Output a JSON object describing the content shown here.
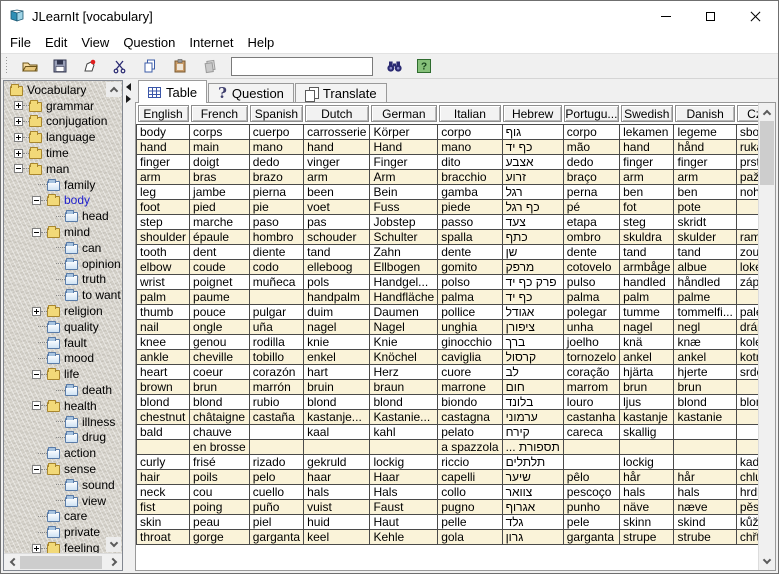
{
  "window": {
    "title": "JLearnIt [vocabulary]"
  },
  "menu": {
    "items": [
      "File",
      "Edit",
      "View",
      "Question",
      "Internet",
      "Help"
    ]
  },
  "toolbar": {
    "search_value": ""
  },
  "tree": {
    "items": [
      {
        "label": "Vocabulary",
        "level": 0,
        "folder": "yellow",
        "handle": null,
        "selected": false
      },
      {
        "label": "grammar",
        "level": 1,
        "folder": "yellow",
        "handle": "plus",
        "selected": false
      },
      {
        "label": "conjugation",
        "level": 1,
        "folder": "yellow",
        "handle": "plus",
        "selected": false
      },
      {
        "label": "language",
        "level": 1,
        "folder": "yellow",
        "handle": "plus",
        "selected": false
      },
      {
        "label": "time",
        "level": 1,
        "folder": "yellow",
        "handle": "plus",
        "selected": false
      },
      {
        "label": "man",
        "level": 1,
        "folder": "yellow",
        "handle": "minus",
        "selected": false
      },
      {
        "label": "family",
        "level": 2,
        "folder": "blue",
        "handle": null,
        "selected": false
      },
      {
        "label": "body",
        "level": 2,
        "folder": "yellow",
        "handle": "minus",
        "selected": true
      },
      {
        "label": "head",
        "level": 3,
        "folder": "blue",
        "handle": null,
        "selected": false
      },
      {
        "label": "mind",
        "level": 2,
        "folder": "yellow",
        "handle": "minus",
        "selected": false
      },
      {
        "label": "can",
        "level": 3,
        "folder": "blue",
        "handle": null,
        "selected": false
      },
      {
        "label": "opinion",
        "level": 3,
        "folder": "blue",
        "handle": null,
        "selected": false
      },
      {
        "label": "truth",
        "level": 3,
        "folder": "blue",
        "handle": null,
        "selected": false
      },
      {
        "label": "to want",
        "level": 3,
        "folder": "blue",
        "handle": null,
        "selected": false
      },
      {
        "label": "religion",
        "level": 2,
        "folder": "yellow",
        "handle": "plus",
        "selected": false
      },
      {
        "label": "quality",
        "level": 2,
        "folder": "blue",
        "handle": null,
        "selected": false
      },
      {
        "label": "fault",
        "level": 2,
        "folder": "blue",
        "handle": null,
        "selected": false
      },
      {
        "label": "mood",
        "level": 2,
        "folder": "blue",
        "handle": null,
        "selected": false
      },
      {
        "label": "life",
        "level": 2,
        "folder": "yellow",
        "handle": "minus",
        "selected": false
      },
      {
        "label": "death",
        "level": 3,
        "folder": "blue",
        "handle": null,
        "selected": false
      },
      {
        "label": "health",
        "level": 2,
        "folder": "yellow",
        "handle": "minus",
        "selected": false
      },
      {
        "label": "illness",
        "level": 3,
        "folder": "blue",
        "handle": null,
        "selected": false
      },
      {
        "label": "drug",
        "level": 3,
        "folder": "blue",
        "handle": null,
        "selected": false
      },
      {
        "label": "action",
        "level": 2,
        "folder": "blue",
        "handle": null,
        "selected": false
      },
      {
        "label": "sense",
        "level": 2,
        "folder": "yellow",
        "handle": "minus",
        "selected": false
      },
      {
        "label": "sound",
        "level": 3,
        "folder": "blue",
        "handle": null,
        "selected": false
      },
      {
        "label": "view",
        "level": 3,
        "folder": "blue",
        "handle": null,
        "selected": false
      },
      {
        "label": "care",
        "level": 2,
        "folder": "blue",
        "handle": null,
        "selected": false
      },
      {
        "label": "private",
        "level": 2,
        "folder": "blue",
        "handle": null,
        "selected": false
      },
      {
        "label": "feeling",
        "level": 2,
        "folder": "yellow",
        "handle": "plus",
        "selected": false
      }
    ]
  },
  "tabs": [
    {
      "label": "Table",
      "icon": "table-icon",
      "selected": true
    },
    {
      "label": "Question",
      "icon": "question-icon",
      "selected": false
    },
    {
      "label": "Translate",
      "icon": "translate-icon",
      "selected": false
    }
  ],
  "table": {
    "columns": [
      "English",
      "French",
      "Spanish",
      "Dutch",
      "German",
      "Italian",
      "Hebrew",
      "Portugu...",
      "Swedish",
      "Danish",
      "Czech"
    ],
    "rtl_column_index": 6,
    "rows": [
      [
        "body",
        "corps",
        "cuerpo",
        "carrosserie",
        "Körper",
        "corpo",
        "גוף",
        "corpo",
        "lekamen",
        "legeme",
        "sbor"
      ],
      [
        "hand",
        "main",
        "mano",
        "hand",
        "Hand",
        "mano",
        "כף יד",
        "mão",
        "hand",
        "hånd",
        "ruka"
      ],
      [
        "finger",
        "doigt",
        "dedo",
        "vinger",
        "Finger",
        "dito",
        "אצבע",
        "dedo",
        "finger",
        "finger",
        "prst"
      ],
      [
        "arm",
        "bras",
        "brazo",
        "arm",
        "Arm",
        "bracchio",
        "זרוע",
        "braço",
        "arm",
        "arm",
        "paže"
      ],
      [
        "leg",
        "jambe",
        "pierna",
        "been",
        "Bein",
        "gamba",
        "רגל",
        "perna",
        "ben",
        "ben",
        "noha"
      ],
      [
        "foot",
        "pied",
        "pie",
        "voet",
        "Fuss",
        "piede",
        "כף רגל",
        "pé",
        "fot",
        "pote",
        ""
      ],
      [
        "step",
        "marche",
        "paso",
        "pas",
        "Jobstep",
        "passo",
        "צעד",
        "etapa",
        "steg",
        "skridt",
        ""
      ],
      [
        "shoulder",
        "épaule",
        "hombro",
        "schouder",
        "Schulter",
        "spalla",
        "כתף",
        "ombro",
        "skuldra",
        "skulder",
        "rameno"
      ],
      [
        "tooth",
        "dent",
        "diente",
        "tand",
        "Zahn",
        "dente",
        "שן",
        "dente",
        "tand",
        "tand",
        "zoubek"
      ],
      [
        "elbow",
        "coude",
        "codo",
        "elleboog",
        "Ellbogen",
        "gomito",
        "מרפק",
        "cotovelo",
        "armbåge",
        "albue",
        "loket"
      ],
      [
        "wrist",
        "poignet",
        "muñeca",
        "pols",
        "Handgel...",
        "polso",
        "פרק כף יד",
        "pulso",
        "handled",
        "håndled",
        "zápěstí"
      ],
      [
        "palm",
        "paume",
        "",
        "handpalm",
        "Handfläche",
        "palma",
        "כף יד",
        "palma",
        "palm",
        "palme",
        ""
      ],
      [
        "thumb",
        "pouce",
        "pulgar",
        "duim",
        "Daumen",
        "pollice",
        "אגודל",
        "polegar",
        "tumme",
        "tommelfi...",
        "palec"
      ],
      [
        "nail",
        "ongle",
        "uña",
        "nagel",
        "Nagel",
        "unghia",
        "ציפורן",
        "unha",
        "nagel",
        "negl",
        "dráp"
      ],
      [
        "knee",
        "genou",
        "rodilla",
        "knie",
        "Knie",
        "ginocchio",
        "ברך",
        "joelho",
        "knä",
        "knæ",
        "koleno"
      ],
      [
        "ankle",
        "cheville",
        "tobillo",
        "enkel",
        "Knöchel",
        "caviglia",
        "קרסול",
        "tornozelo",
        "ankel",
        "ankel",
        "kotník"
      ],
      [
        "heart",
        "coeur",
        "corazón",
        "hart",
        "Herz",
        "cuore",
        "לב",
        "coração",
        "hjärta",
        "hjerte",
        "srdce"
      ],
      [
        "brown",
        "brun",
        "marrón",
        "bruin",
        "braun",
        "marrone",
        "חום",
        "marrom",
        "brun",
        "brun",
        ""
      ],
      [
        "blond",
        "blond",
        "rubio",
        "blond",
        "blond",
        "biondo",
        "בלונד",
        "louro",
        "ljus",
        "blond",
        "blond"
      ],
      [
        "chestnut",
        "châtaigne",
        "castaña",
        "kastanje...",
        "Kastanie...",
        "castagna",
        "ערמוני",
        "castanha",
        "kastanje",
        "kastanie",
        ""
      ],
      [
        "bald",
        "chauve",
        "",
        "kaal",
        "kahl",
        "pelato",
        "קירח",
        "careca",
        "skallig",
        "",
        ""
      ],
      [
        "",
        "en brosse",
        "",
        "",
        "",
        "a spazzola",
        "... תספורת",
        "",
        "",
        "",
        ""
      ],
      [
        "curly",
        "frisé",
        "rizado",
        "gekruld",
        "lockig",
        "riccio",
        "תלתלים",
        "",
        "lockig",
        "",
        "kadeřavý"
      ],
      [
        "hair",
        "poils",
        "pelo",
        "haar",
        "Haar",
        "capelli",
        "שיער",
        "pêlo",
        "hår",
        "hår",
        "chlup"
      ],
      [
        "neck",
        "cou",
        "cuello",
        "hals",
        "Hals",
        "collo",
        "צוואר",
        "pescoço",
        "hals",
        "hals",
        "hrdlo"
      ],
      [
        "fist",
        "poing",
        "puño",
        "vuist",
        "Faust",
        "pugno",
        "אגרוף",
        "punho",
        "näve",
        "næve",
        "pěst"
      ],
      [
        "skin",
        "peau",
        "piel",
        "huid",
        "Haut",
        "pelle",
        "גלד",
        "pele",
        "skinn",
        "skind",
        "kůže"
      ],
      [
        "throat",
        "gorge",
        "garganta",
        "keel",
        "Kehle",
        "gola",
        "גרון",
        "garganta",
        "strupe",
        "strube",
        "chřtán"
      ]
    ]
  },
  "colors": {
    "titlebar_bg": "#ffffff",
    "toolbar_bg": "#f0f0f0",
    "row_alt": "#faf3d9",
    "grid_line": "#4a4a4a",
    "tree_selected_text": "#2020cc",
    "folder_yellow": "#f2d978",
    "folder_blue": "#d7e6f5",
    "help_green": "#86c07a",
    "scrollbar_thumb": "#cdcdcd"
  }
}
